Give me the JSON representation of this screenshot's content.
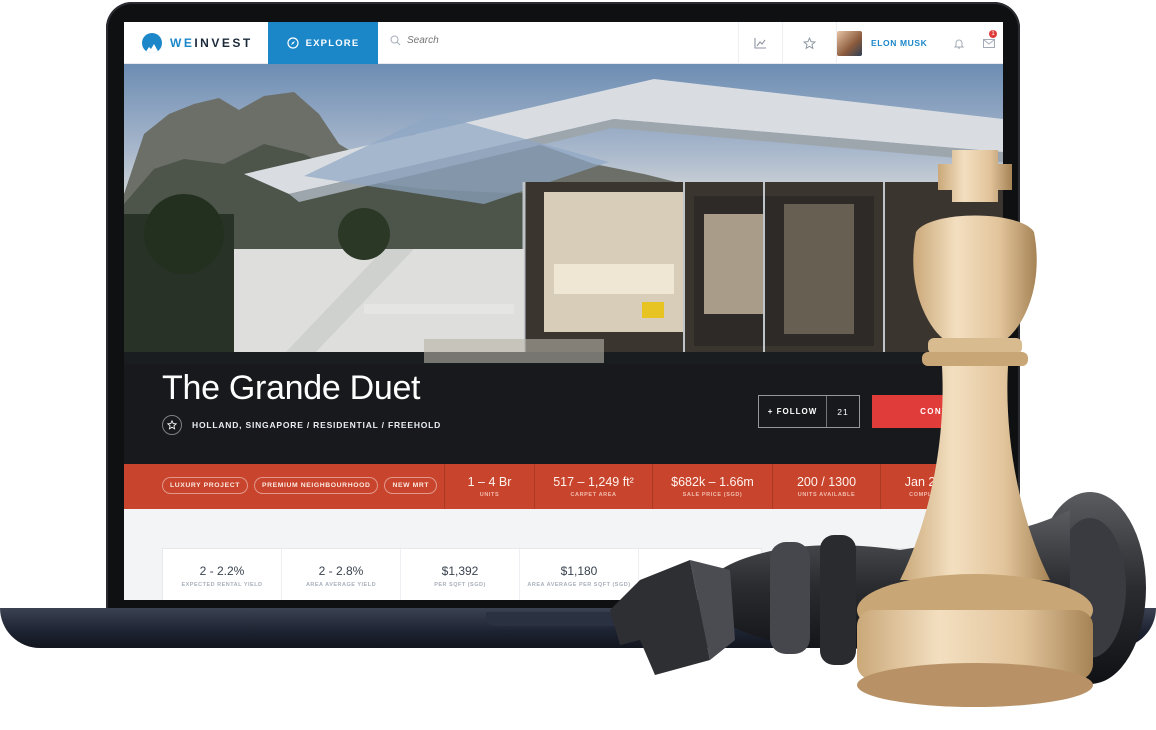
{
  "header": {
    "logo_text_we": "WE",
    "logo_text_invest": "INVEST",
    "explore_label": "EXPLORE",
    "search_placeholder": "Search",
    "user_name": "ELON MUSK",
    "message_badge": "1",
    "icons": [
      "chart-icon",
      "star-icon",
      "bell-icon",
      "mail-icon",
      "compass-icon",
      "search-icon"
    ]
  },
  "hero": {
    "title": "The Grande Duet",
    "subtitle": "HOLLAND, SINGAPORE / RESIDENTIAL / FREEHOLD",
    "follow_label": "+ FOLLOW",
    "follow_count": "21",
    "contact_label": "CONTA"
  },
  "tags": [
    "LUXURY PROJECT",
    "PREMIUM NEIGHBOURHOOD",
    "NEW MRT"
  ],
  "stats": [
    {
      "value": "1 – 4 Br",
      "label": "UNITS"
    },
    {
      "value": "517 – 1,249 ft²",
      "label": "CARPET AREA"
    },
    {
      "value": "$682k – 1.66m",
      "label": "SALE PRICE (SGD)"
    },
    {
      "value": "200 / 1300",
      "label": "UNITS AVAILABLE"
    },
    {
      "value": "Jan 2015",
      "label": "COMPLETION"
    }
  ],
  "metrics": [
    {
      "value": "2 - 2.2%",
      "label": "EXPECTED RENTAL YIELD"
    },
    {
      "value": "2 - 2.8%",
      "label": "AREA AVERAGE YIELD"
    },
    {
      "value": "$1,392",
      "label": "PER SQFT (SGD)"
    },
    {
      "value": "$1,180",
      "label": "AREA AVERAGE PER SQFT (SGD)"
    },
    {
      "value": "$",
      "label": ""
    }
  ],
  "colors": {
    "brand_blue": "#1b87c9",
    "contact_red": "#e03c3a",
    "stats_bar": "#c8442c"
  }
}
